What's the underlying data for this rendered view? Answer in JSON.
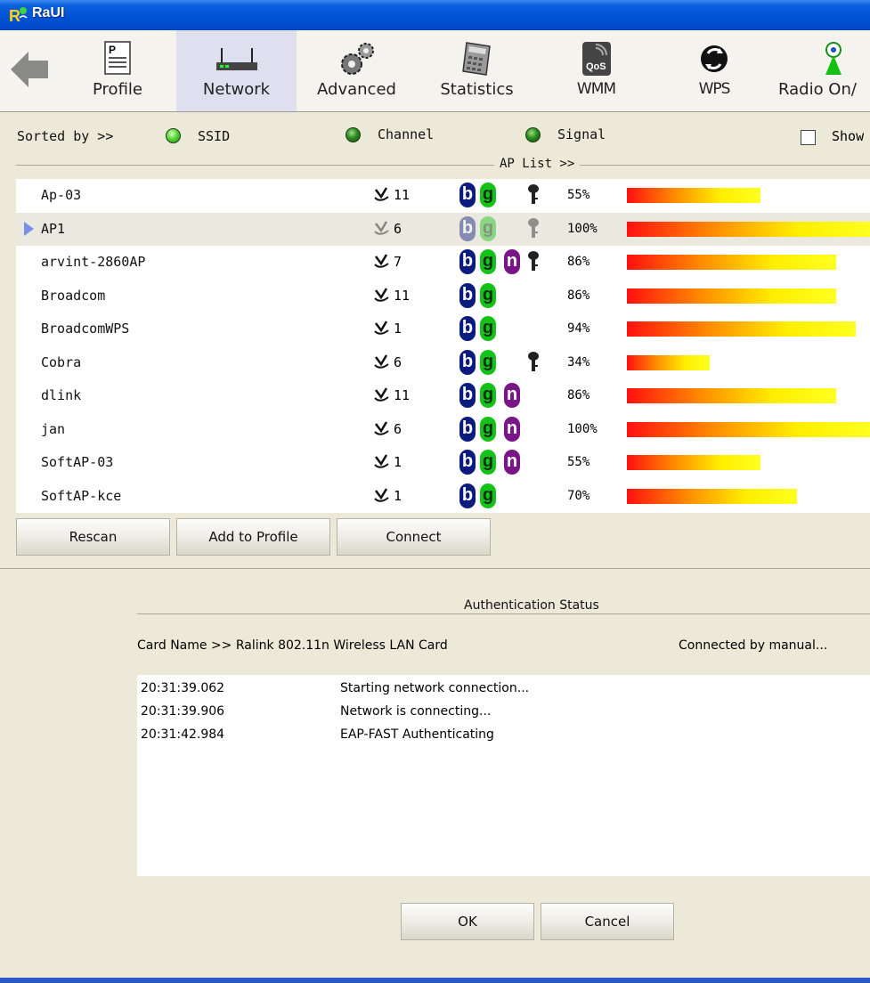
{
  "window": {
    "title": "RaUI"
  },
  "toolbar": {
    "back_label": "",
    "items": [
      {
        "label": "Profile"
      },
      {
        "label": "Network"
      },
      {
        "label": "Advanced"
      },
      {
        "label": "Statistics"
      },
      {
        "label": "WMM"
      },
      {
        "label": "WPS"
      },
      {
        "label": "Radio On/"
      }
    ],
    "qos_text": "QoS"
  },
  "sort": {
    "prefix": "Sorted by >>",
    "options": [
      "SSID",
      "Channel",
      "Signal"
    ],
    "show_label": "Show"
  },
  "ap_list": {
    "title": "AP List >>",
    "rows": [
      {
        "ssid": "Ap-03",
        "channel": "11",
        "b": true,
        "g": true,
        "n": false,
        "secured": true,
        "signal": "55%",
        "signal_level": 0.55,
        "selected": false
      },
      {
        "ssid": "AP1",
        "channel": "6",
        "b": true,
        "g": true,
        "n": false,
        "secured": true,
        "signal": "100%",
        "signal_level": 1.0,
        "selected": true
      },
      {
        "ssid": "arvint-2860AP",
        "channel": "7",
        "b": true,
        "g": true,
        "n": true,
        "secured": true,
        "signal": "86%",
        "signal_level": 0.86,
        "selected": false
      },
      {
        "ssid": "Broadcom",
        "channel": "11",
        "b": true,
        "g": true,
        "n": false,
        "secured": false,
        "signal": "86%",
        "signal_level": 0.86,
        "selected": false
      },
      {
        "ssid": "BroadcomWPS",
        "channel": "1",
        "b": true,
        "g": true,
        "n": false,
        "secured": false,
        "signal": "94%",
        "signal_level": 0.94,
        "selected": false
      },
      {
        "ssid": "Cobra",
        "channel": "6",
        "b": true,
        "g": true,
        "n": false,
        "secured": true,
        "signal": "34%",
        "signal_level": 0.34,
        "selected": false
      },
      {
        "ssid": "dlink",
        "channel": "11",
        "b": true,
        "g": true,
        "n": true,
        "secured": false,
        "signal": "86%",
        "signal_level": 0.86,
        "selected": false
      },
      {
        "ssid": "jan",
        "channel": "6",
        "b": true,
        "g": true,
        "n": true,
        "secured": false,
        "signal": "100%",
        "signal_level": 1.0,
        "selected": false
      },
      {
        "ssid": "SoftAP-03",
        "channel": "1",
        "b": true,
        "g": true,
        "n": true,
        "secured": false,
        "signal": "55%",
        "signal_level": 0.55,
        "selected": false
      },
      {
        "ssid": "SoftAP-kce",
        "channel": "1",
        "b": true,
        "g": true,
        "n": false,
        "secured": false,
        "signal": "70%",
        "signal_level": 0.7,
        "selected": false
      }
    ]
  },
  "buttons": {
    "rescan": "Rescan",
    "add_to_profile": "Add to Profile",
    "connect": "Connect",
    "ok": "OK",
    "cancel": "Cancel"
  },
  "auth": {
    "title": "Authentication Status",
    "card_name": "Card Name >> Ralink 802.11n Wireless LAN Card",
    "connected_by": "Connected by manual...",
    "log": [
      {
        "time": "20:31:39.062",
        "message": "Starting network connection..."
      },
      {
        "time": "20:31:39.906",
        "message": "Network is connecting..."
      },
      {
        "time": "20:31:42.984",
        "message": "EAP-FAST Authenticating"
      }
    ]
  },
  "colors": {
    "title_bar": "#0052d6",
    "window_bg": "#ece9d8",
    "selected_row": "#eae8df",
    "badge_b": "#0c1b7e",
    "badge_g": "#15c21a",
    "badge_n": "#7a1588"
  }
}
